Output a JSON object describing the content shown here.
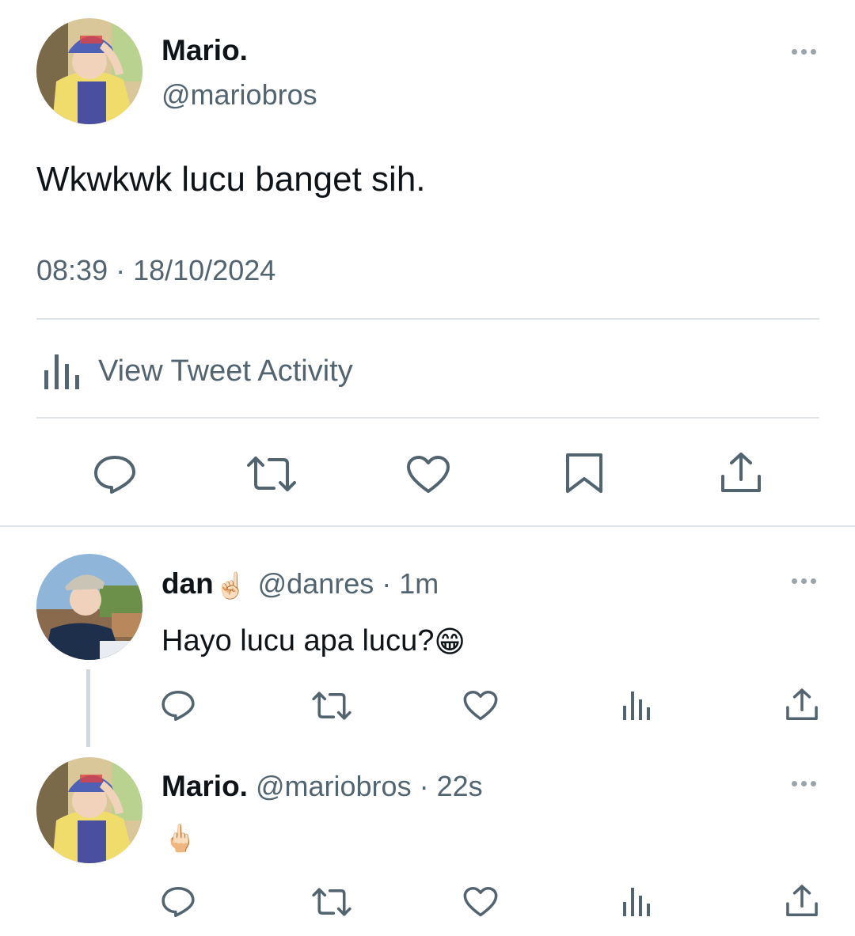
{
  "main_tweet": {
    "display_name": "Mario.",
    "handle": "@mariobros",
    "text": "Wkwkwk lucu banget sih.",
    "timestamp": "08:39 · 18/10/2024",
    "activity_label": "View Tweet Activity",
    "icons": [
      "reply-icon",
      "retweet-icon",
      "like-icon",
      "bookmark-icon",
      "share-icon"
    ]
  },
  "replies": [
    {
      "display_name": "dan",
      "name_emoji": "☝🏻",
      "handle": "@danres",
      "sep": "·",
      "time": "1m",
      "text": "Hayo lucu apa lucu?",
      "text_emoji": "😁",
      "icons": [
        "reply-icon",
        "retweet-icon",
        "like-icon",
        "analytics-icon",
        "share-icon"
      ]
    },
    {
      "display_name": "Mario.",
      "handle": "@mariobros",
      "sep": "·",
      "time": "22s",
      "text_emoji": "🖕🏻",
      "icons": [
        "reply-icon",
        "retweet-icon",
        "like-icon",
        "analytics-icon",
        "share-icon"
      ]
    }
  ],
  "colors": {
    "text": "#0f1419",
    "muted": "#536471",
    "divider": "#dfe4e8",
    "thread_line": "#cfd9de"
  }
}
